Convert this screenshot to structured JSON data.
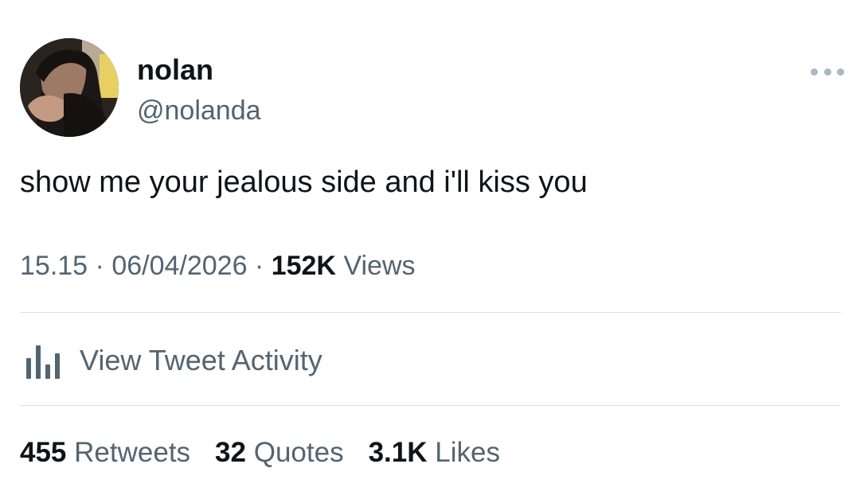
{
  "author": {
    "display_name": "nolan",
    "handle": "@nolanda"
  },
  "tweet": {
    "text": "show me your jealous side and i'll kiss you"
  },
  "meta": {
    "time": "15.15",
    "separator": " · ",
    "date": "06/04/2026",
    "views_count": "152K",
    "views_label": "Views"
  },
  "activity": {
    "label": "View Tweet Activity",
    "icon": "bar-chart-icon"
  },
  "stats": {
    "retweets_count": "455",
    "retweets_label": "Retweets",
    "quotes_count": "32",
    "quotes_label": "Quotes",
    "likes_count": "3.1K",
    "likes_label": "Likes"
  },
  "icons": {
    "more": "more-options-icon"
  },
  "colors": {
    "primary_text": "#0f1419",
    "secondary_text": "#536471",
    "divider": "#dcdfe3",
    "more_dots": "#aab8c2"
  }
}
